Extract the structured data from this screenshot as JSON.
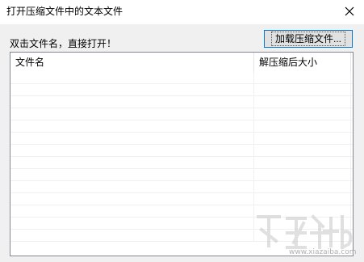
{
  "window": {
    "title": "打开压缩文件中的文本文件",
    "close_icon": "close-icon"
  },
  "hint": "双击文件名，直接打开！",
  "load_button_label": "加载压缩文件...",
  "list": {
    "columns": [
      "文件名",
      "解压缩后大小"
    ],
    "rows": []
  },
  "watermark": {
    "text": "www.xiazaiba.com"
  }
}
